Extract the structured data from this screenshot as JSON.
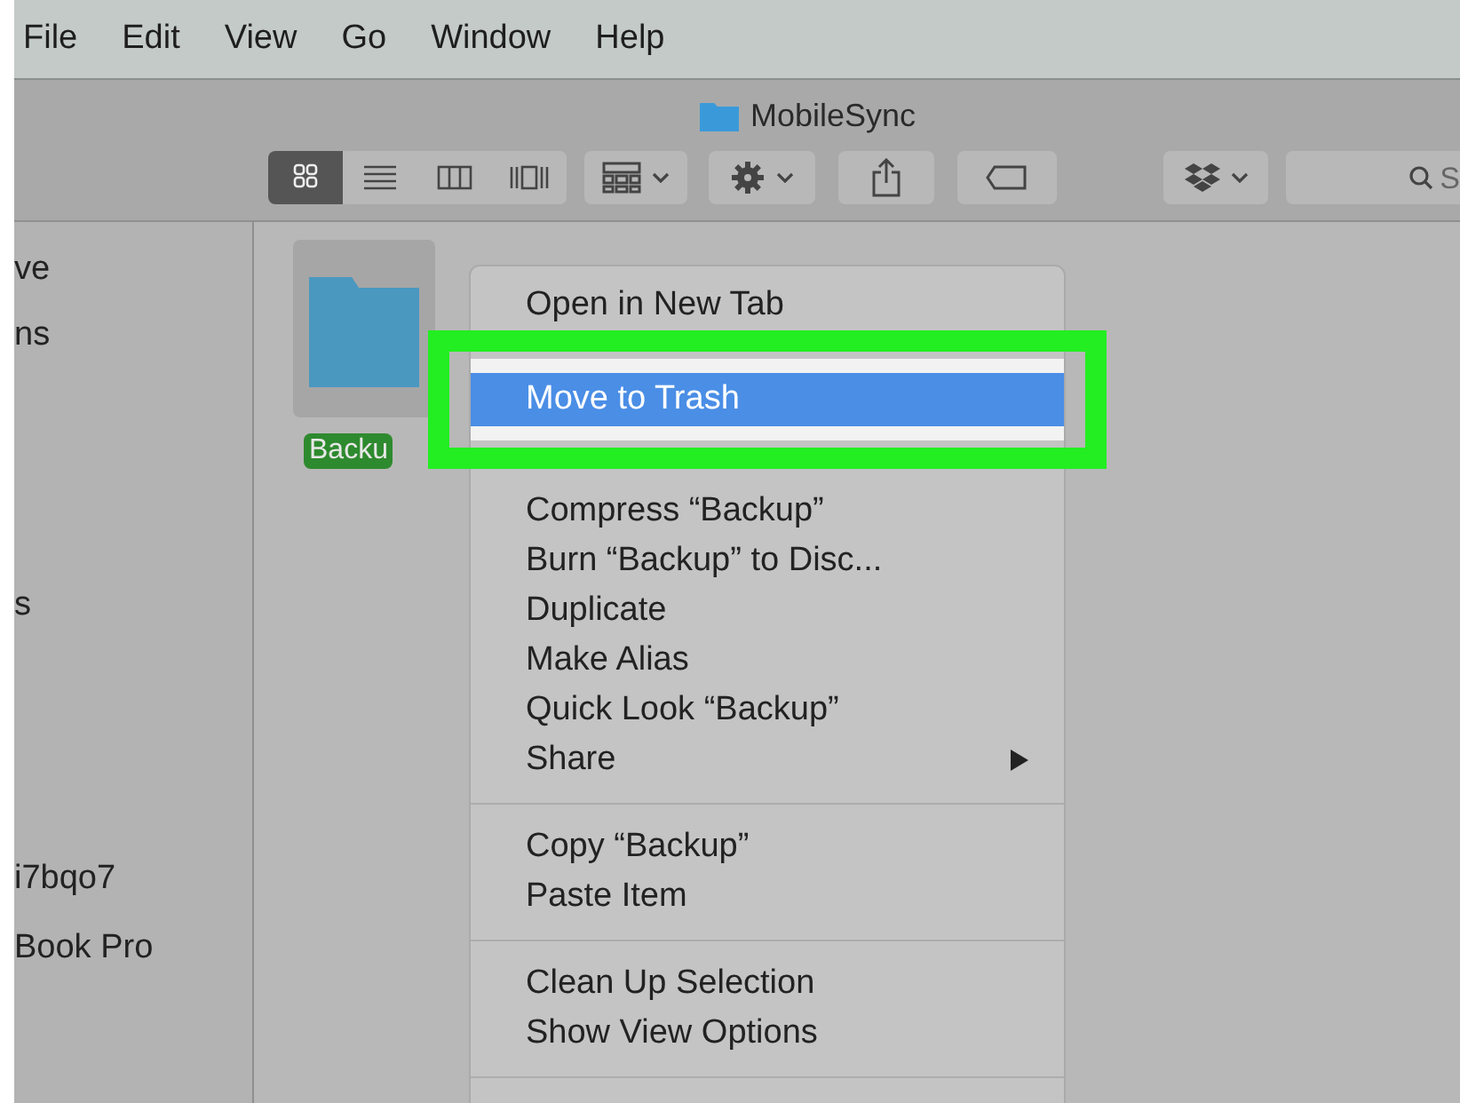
{
  "menu_bar": [
    "File",
    "Edit",
    "View",
    "Go",
    "Window",
    "Help"
  ],
  "window": {
    "title": "MobileSync"
  },
  "toolbar": {
    "view_modes": [
      {
        "kind": "icons",
        "selected": true
      },
      {
        "kind": "list",
        "selected": false
      },
      {
        "kind": "columns",
        "selected": false
      },
      {
        "kind": "coverflow",
        "selected": false
      }
    ],
    "search": {
      "placeholder": "S"
    }
  },
  "sidebar": {
    "items": [
      "ve",
      "ns",
      "s",
      "i7bqo7",
      "Book Pro"
    ]
  },
  "files": [
    {
      "name": "Backu",
      "selected": true
    }
  ],
  "context_menu": {
    "items": [
      {
        "kind": "item",
        "label": "Open in New Tab",
        "selected": false
      },
      {
        "kind": "item",
        "label": "Move to Trash",
        "selected": true
      },
      {
        "kind": "item",
        "label": "Compress “Backup”",
        "selected": false
      },
      {
        "kind": "item",
        "label": "Burn “Backup” to Disc...",
        "selected": false
      },
      {
        "kind": "item",
        "label": "Duplicate",
        "selected": false
      },
      {
        "kind": "item",
        "label": "Make Alias",
        "selected": false
      },
      {
        "kind": "item",
        "label": "Quick Look “Backup”",
        "selected": false
      },
      {
        "kind": "submenu",
        "label": "Share",
        "selected": false
      },
      {
        "kind": "separator"
      },
      {
        "kind": "item",
        "label": "Copy “Backup”",
        "selected": false
      },
      {
        "kind": "item",
        "label": "Paste Item",
        "selected": false
      },
      {
        "kind": "separator"
      },
      {
        "kind": "item",
        "label": "Clean Up Selection",
        "selected": false
      },
      {
        "kind": "item",
        "label": "Show View Options",
        "selected": false
      },
      {
        "kind": "separator"
      }
    ]
  }
}
